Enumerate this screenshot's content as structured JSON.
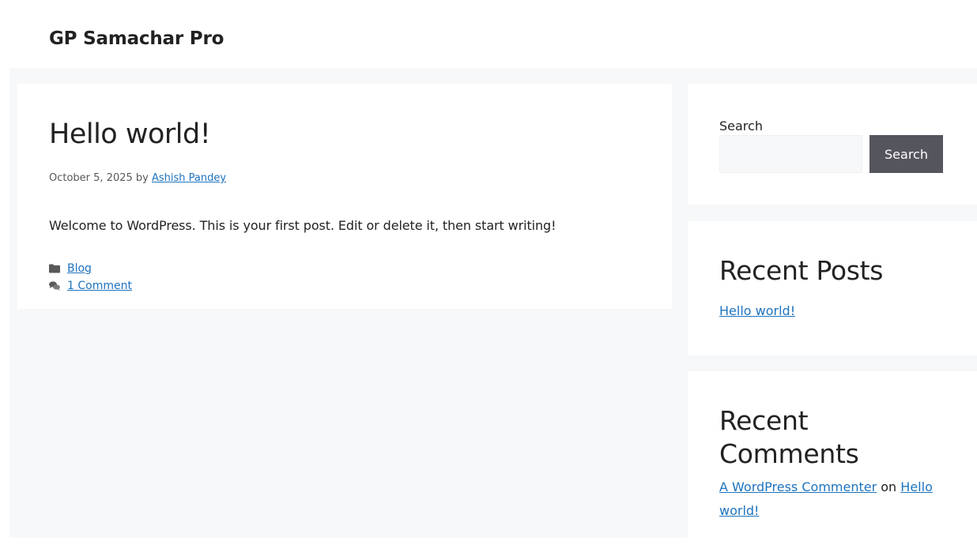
{
  "header": {
    "site_title": "GP Samachar Pro"
  },
  "post": {
    "title": "Hello world!",
    "date": "October 5, 2025",
    "by": "by",
    "author": "Ashish Pandey",
    "content": "Welcome to WordPress. This is your first post. Edit or delete it, then start writing!",
    "category_link": "Blog",
    "comments_link": "1 Comment"
  },
  "sidebar": {
    "search": {
      "label": "Search",
      "button_label": "Search",
      "input_value": ""
    },
    "recent_posts": {
      "title": "Recent Posts",
      "items": [
        "Hello world!"
      ]
    },
    "recent_comments": {
      "title": "Recent Comments",
      "items": [
        {
          "author": "A WordPress Commenter",
          "on": "on",
          "post": "Hello world!"
        }
      ]
    }
  },
  "colors": {
    "link": "#1e73be",
    "body_bg": "#f7f8f9",
    "button_bg": "#55555e",
    "text": "#222222"
  },
  "icons": {
    "category": "folder-icon",
    "comments": "comments-icon"
  }
}
